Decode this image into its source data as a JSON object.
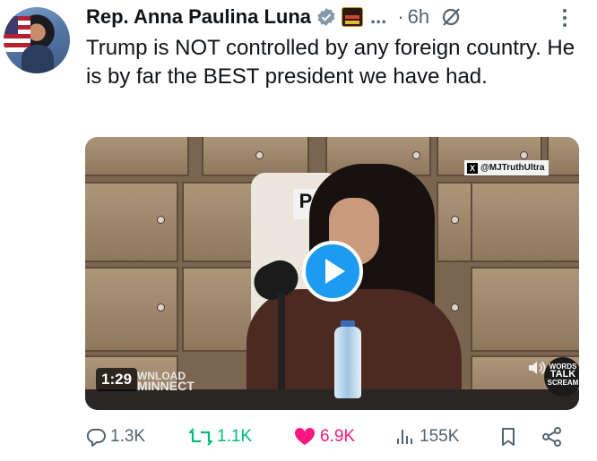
{
  "author": {
    "name": "Rep. Anna Paulina Luna",
    "truncation": "...",
    "separator": "·",
    "time": "6h"
  },
  "tweet": {
    "text": "Trump is NOT controlled by any foreign country. He is by far the BEST president we have had."
  },
  "media": {
    "watermark_handle": "@MJTruthUltra",
    "studio_sign": "P",
    "duration": "1:29",
    "download_watermark_line1": "WNLOAD",
    "download_watermark_line2": "MINNECT",
    "badge_line1": "WORDS",
    "badge_line2": "TALK",
    "badge_line3": "SCREAM"
  },
  "actions": {
    "replies": "1.3K",
    "reposts": "1.1K",
    "likes": "6.9K",
    "views": "155K"
  },
  "colors": {
    "accent": "#1d9bf0",
    "repost": "#00ba7c",
    "like": "#f91880",
    "muted": "#536471"
  },
  "icons": [
    "verified-badge-icon",
    "affiliation-badge-icon",
    "grok-icon",
    "more-icon",
    "play-icon",
    "reply-icon",
    "repost-icon",
    "like-icon",
    "views-icon",
    "bookmark-icon",
    "share-icon",
    "sound-icon"
  ]
}
